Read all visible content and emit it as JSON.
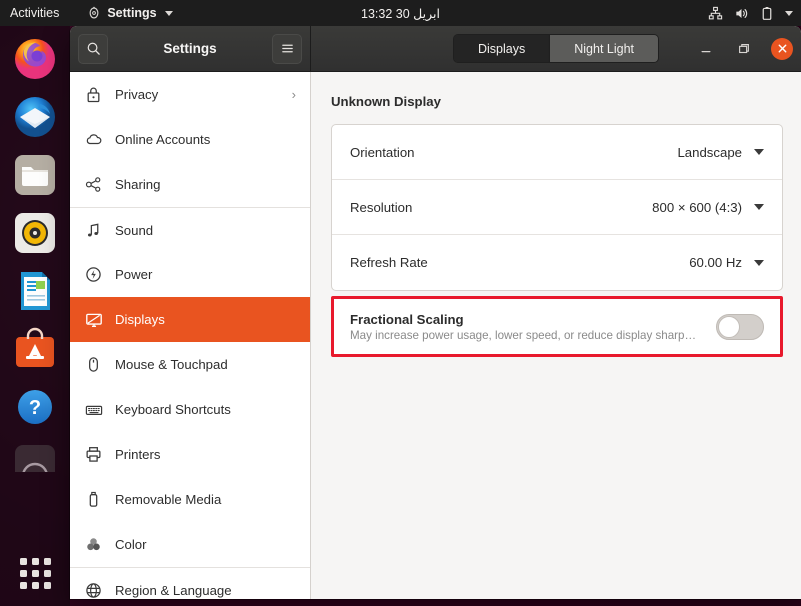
{
  "topbar": {
    "activities": "Activities",
    "app_menu": "Settings",
    "clock": "ابريل 30  13:32",
    "tray_icons": [
      "network-wired-icon",
      "volume-icon",
      "battery-icon",
      "chevron-down-icon"
    ]
  },
  "dock": {
    "items": [
      {
        "name": "firefox",
        "label": "Firefox"
      },
      {
        "name": "thunderbird",
        "label": "Thunderbird Mail"
      },
      {
        "name": "files",
        "label": "Files"
      },
      {
        "name": "rhythmbox",
        "label": "Rhythmbox"
      },
      {
        "name": "libreoffice-writer",
        "label": "LibreOffice Writer"
      },
      {
        "name": "ubuntu-software",
        "label": "Ubuntu Software"
      },
      {
        "name": "help",
        "label": "Help"
      },
      {
        "name": "partial-app",
        "label": "Application"
      }
    ],
    "show_apps": "Show Applications"
  },
  "window": {
    "title": "Settings",
    "search_icon": "search-icon",
    "menu_icon": "hamburger-menu-icon",
    "tabs": [
      {
        "label": "Displays",
        "active": true
      },
      {
        "label": "Night Light",
        "active": false
      }
    ],
    "controls": {
      "minimize": "Minimize",
      "maximize": "Maximize",
      "close": "Close"
    }
  },
  "sidebar": {
    "items": [
      {
        "label": "Privacy",
        "icon": "lock-icon",
        "active": false,
        "chevron": "›",
        "separator": false
      },
      {
        "label": "Online Accounts",
        "icon": "cloud-icon",
        "active": false,
        "separator": false
      },
      {
        "label": "Sharing",
        "icon": "share-icon",
        "active": false,
        "separator": false
      },
      {
        "label": "Sound",
        "icon": "music-note-icon",
        "active": false,
        "separator": true
      },
      {
        "label": "Power",
        "icon": "power-icon",
        "active": false,
        "separator": false
      },
      {
        "label": "Displays",
        "icon": "display-icon",
        "active": true,
        "separator": false
      },
      {
        "label": "Mouse & Touchpad",
        "icon": "mouse-icon",
        "active": false,
        "separator": false
      },
      {
        "label": "Keyboard Shortcuts",
        "icon": "keyboard-icon",
        "active": false,
        "separator": false
      },
      {
        "label": "Printers",
        "icon": "printer-icon",
        "active": false,
        "separator": false
      },
      {
        "label": "Removable Media",
        "icon": "usb-drive-icon",
        "active": false,
        "separator": false
      },
      {
        "label": "Color",
        "icon": "color-icon",
        "active": false,
        "separator": false
      },
      {
        "label": "Region & Language",
        "icon": "globe-icon",
        "active": false,
        "separator": true
      }
    ]
  },
  "main": {
    "display_name": "Unknown Display",
    "rows": [
      {
        "label": "Orientation",
        "value": "Landscape"
      },
      {
        "label": "Resolution",
        "value": "800 × 600 (4:3)"
      },
      {
        "label": "Refresh Rate",
        "value": "60.00 Hz"
      }
    ],
    "fractional_scaling": {
      "title": "Fractional Scaling",
      "subtitle": "May increase power usage, lower speed, or reduce display sharp…",
      "enabled": false
    }
  },
  "colors": {
    "ubuntu_orange": "#E95420",
    "highlight_red": "#E8192C",
    "titlebar": "#303030",
    "panel_bg": "#F6F5F4"
  }
}
